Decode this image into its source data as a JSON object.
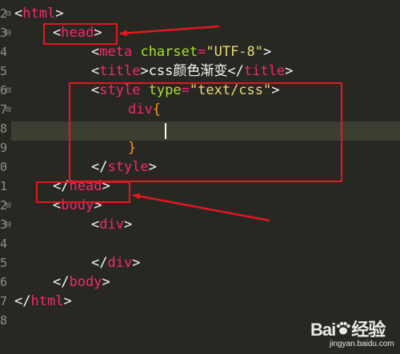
{
  "editor": {
    "line_numbers": [
      "2",
      "3",
      "4",
      "5",
      "6",
      "7",
      "8",
      "9",
      "0",
      "1",
      "2",
      "3",
      "4",
      "5",
      "6",
      "7",
      "8"
    ],
    "lines": [
      {
        "tokens": [
          {
            "t": "<",
            "c": "punct"
          },
          {
            "t": "html",
            "c": "tag"
          },
          {
            "t": ">",
            "c": "punct"
          }
        ]
      },
      {
        "tokens": [
          {
            "t": "<",
            "c": "punct"
          },
          {
            "t": "head",
            "c": "tag"
          },
          {
            "t": ">",
            "c": "punct"
          }
        ]
      },
      {
        "tokens": [
          {
            "t": "<",
            "c": "punct"
          },
          {
            "t": "meta",
            "c": "tag"
          },
          {
            "t": " ",
            "c": "text"
          },
          {
            "t": "charset",
            "c": "attr"
          },
          {
            "t": "=",
            "c": "eq"
          },
          {
            "t": "\"UTF-8\"",
            "c": "str"
          },
          {
            "t": ">",
            "c": "punct"
          }
        ]
      },
      {
        "tokens": [
          {
            "t": "<",
            "c": "punct"
          },
          {
            "t": "title",
            "c": "tag"
          },
          {
            "t": ">",
            "c": "punct"
          },
          {
            "t": "css颜色渐变",
            "c": "text"
          },
          {
            "t": "</",
            "c": "punct"
          },
          {
            "t": "title",
            "c": "tag"
          },
          {
            "t": ">",
            "c": "punct"
          }
        ]
      },
      {
        "tokens": [
          {
            "t": "<",
            "c": "punct"
          },
          {
            "t": "style",
            "c": "tag"
          },
          {
            "t": " ",
            "c": "text"
          },
          {
            "t": "type",
            "c": "attr"
          },
          {
            "t": "=",
            "c": "eq"
          },
          {
            "t": "\"text/css\"",
            "c": "str"
          },
          {
            "t": ">",
            "c": "punct"
          }
        ]
      },
      {
        "tokens": [
          {
            "t": "div",
            "c": "selector"
          },
          {
            "t": "{",
            "c": "brace"
          }
        ]
      },
      {
        "tokens": []
      },
      {
        "tokens": [
          {
            "t": "}",
            "c": "brace"
          }
        ]
      },
      {
        "tokens": [
          {
            "t": "</",
            "c": "punct"
          },
          {
            "t": "style",
            "c": "tag"
          },
          {
            "t": ">",
            "c": "punct"
          }
        ]
      },
      {
        "tokens": [
          {
            "t": "</",
            "c": "punct"
          },
          {
            "t": "head",
            "c": "tag"
          },
          {
            "t": ">",
            "c": "punct"
          }
        ]
      },
      {
        "tokens": [
          {
            "t": "<",
            "c": "punct"
          },
          {
            "t": "body",
            "c": "tag"
          },
          {
            "t": ">",
            "c": "punct"
          }
        ]
      },
      {
        "tokens": [
          {
            "t": "<",
            "c": "punct"
          },
          {
            "t": "div",
            "c": "tag"
          },
          {
            "t": ">",
            "c": "punct"
          }
        ]
      },
      {
        "tokens": []
      },
      {
        "tokens": [
          {
            "t": "</",
            "c": "punct"
          },
          {
            "t": "div",
            "c": "tag"
          },
          {
            "t": ">",
            "c": "punct"
          }
        ]
      },
      {
        "tokens": [
          {
            "t": "</",
            "c": "punct"
          },
          {
            "t": "body",
            "c": "tag"
          },
          {
            "t": ">",
            "c": "punct"
          }
        ]
      },
      {
        "tokens": [
          {
            "t": "</",
            "c": "punct"
          },
          {
            "t": "html",
            "c": "tag"
          },
          {
            "t": ">",
            "c": "punct"
          }
        ]
      },
      {
        "tokens": []
      }
    ],
    "fold_markers": [
      "⊟",
      "⊟",
      "",
      "",
      "⊟",
      "⊟",
      "",
      "",
      "",
      "",
      "⊟",
      "⊟",
      "",
      "",
      "",
      "",
      ""
    ]
  },
  "colors": {
    "background": "#272822",
    "tag": "#f92672",
    "attribute": "#a6e22e",
    "string": "#e6db74",
    "text": "#f8f8f2",
    "brace": "#fd971f",
    "annotation": "#e5171f"
  },
  "watermark": {
    "brand_left": "Bai",
    "brand_icon": "paw-icon",
    "brand_right": "经验",
    "url": "jingyan.baidu.com"
  }
}
